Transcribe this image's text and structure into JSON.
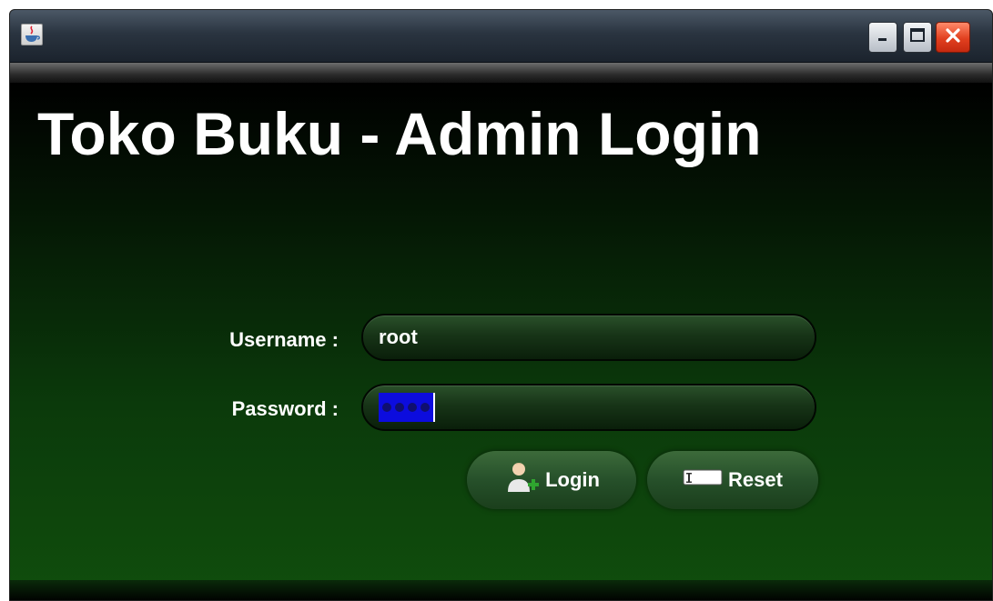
{
  "window": {
    "app_icon": "java-coffee-icon",
    "controls": [
      "minimize-icon",
      "maximize-icon",
      "close-icon"
    ]
  },
  "main": {
    "title": "Toko Buku - Admin Login",
    "username_label": "Username :",
    "username_value": "root",
    "password_label": "Password :",
    "password_masked_length": 4,
    "login_label": "Login",
    "login_icon": "user-add-icon",
    "reset_label": "Reset",
    "reset_icon": "textfield-icon"
  },
  "colors": {
    "background_top": "#000000",
    "background_bottom": "#104e0d",
    "selection": "#0c0cde",
    "close_button": "#e1401f"
  }
}
